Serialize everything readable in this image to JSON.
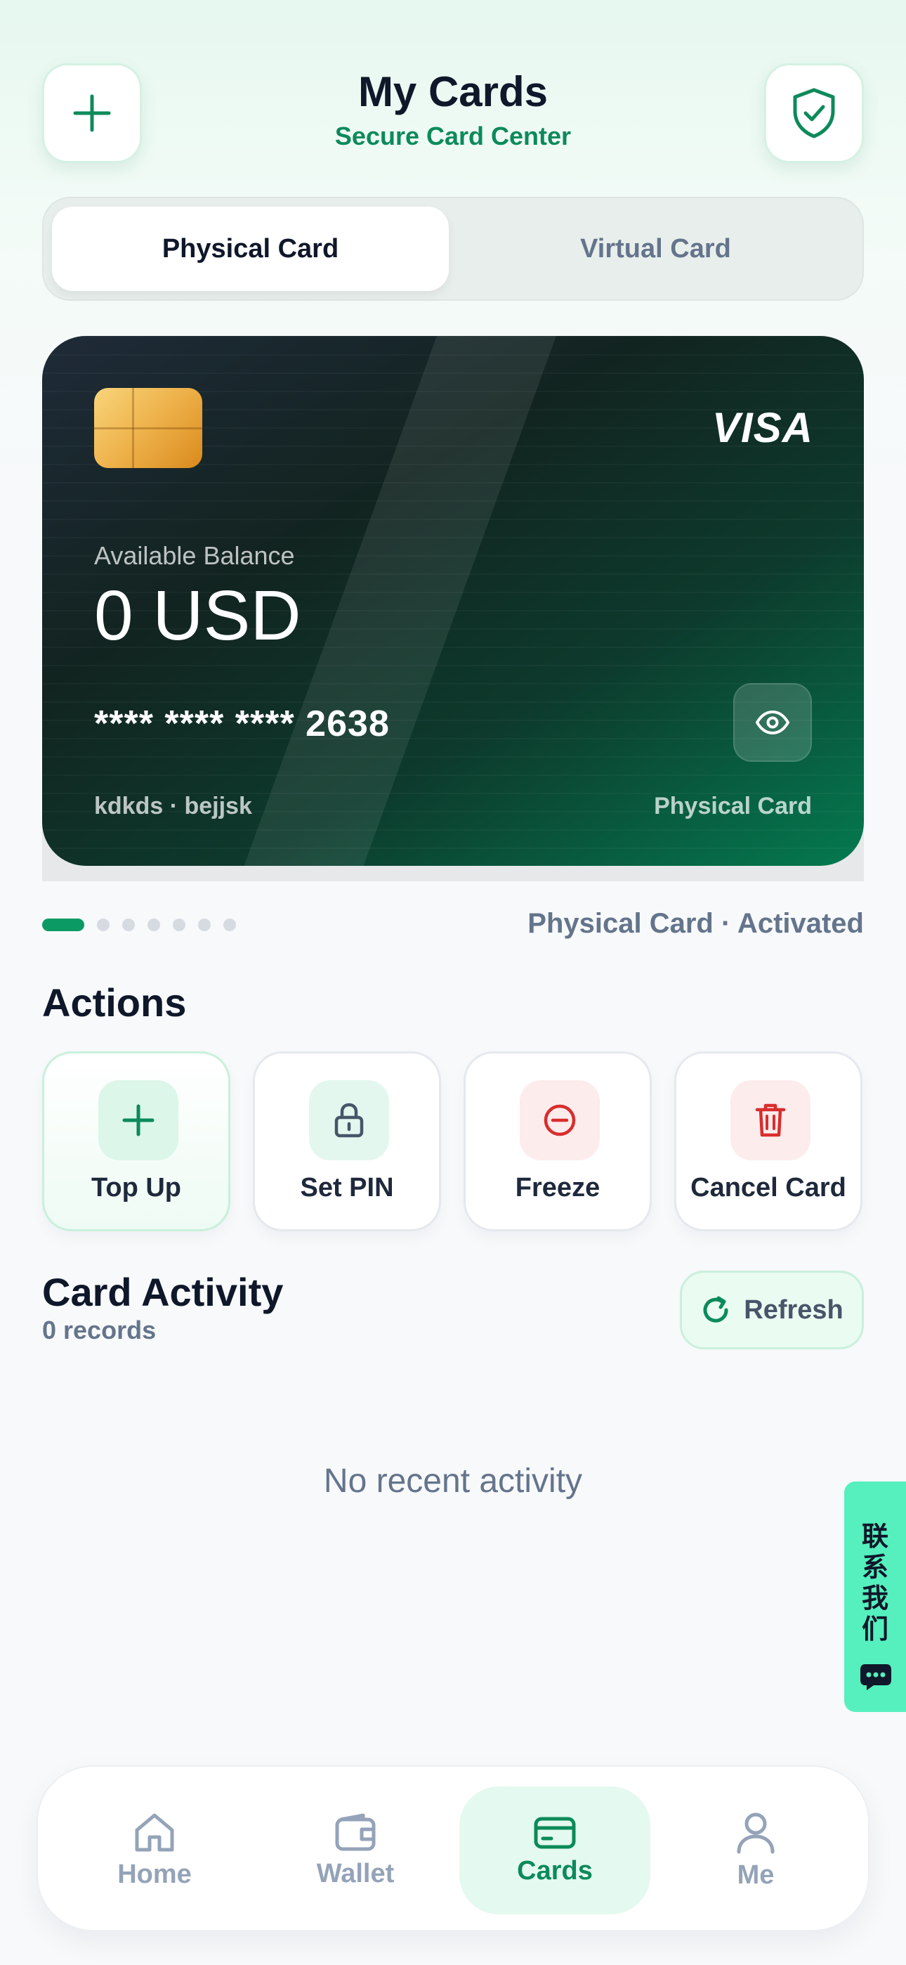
{
  "header": {
    "title": "My Cards",
    "subtitle": "Secure Card Center",
    "add_icon": "plus-icon",
    "security_icon": "shield-check-icon"
  },
  "segment": {
    "tabs": [
      {
        "label": "Physical Card",
        "active": true
      },
      {
        "label": "Virtual Card",
        "active": false
      }
    ]
  },
  "card": {
    "brand": "VISA",
    "balance_label": "Available Balance",
    "balance_value": "0 USD",
    "number": "**** **** **** 2638",
    "holder": "kdkds · bejjsk",
    "type": "Physical Card",
    "toggle_icon": "eye-icon"
  },
  "pager": {
    "total": 7,
    "active_index": 0,
    "status": "Physical Card · Activated"
  },
  "actions": {
    "title": "Actions",
    "items": [
      {
        "label": "Top Up",
        "icon": "plus-icon"
      },
      {
        "label": "Set PIN",
        "icon": "lock-icon"
      },
      {
        "label": "Freeze",
        "icon": "minus-circle-icon"
      },
      {
        "label": "Cancel Card",
        "icon": "trash-icon"
      }
    ]
  },
  "activity": {
    "title": "Card Activity",
    "count": "0 records",
    "refresh_label": "Refresh",
    "empty": "No recent activity"
  },
  "contact": {
    "label": "联系我们",
    "icon": "chat-icon"
  },
  "nav": {
    "items": [
      {
        "label": "Home",
        "icon": "home-icon",
        "active": false
      },
      {
        "label": "Wallet",
        "icon": "wallet-icon",
        "active": false
      },
      {
        "label": "Cards",
        "icon": "card-icon",
        "active": true
      },
      {
        "label": "Me",
        "icon": "user-icon",
        "active": false
      }
    ]
  },
  "colors": {
    "accent": "#0c8a5a",
    "active_dot": "#0c9a64",
    "contact_tab": "#55f0bd",
    "danger": "#d92d2d"
  }
}
